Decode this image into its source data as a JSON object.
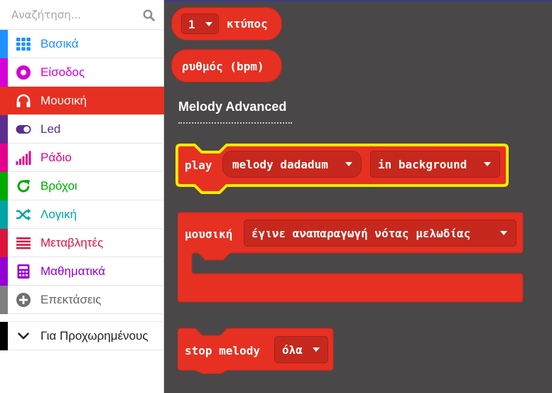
{
  "search": {
    "placeholder": "Αναζήτηση..."
  },
  "categories": [
    {
      "id": "basic",
      "label": "Βασικά",
      "color": "#1e90ff",
      "icon": "grid-icon"
    },
    {
      "id": "input",
      "label": "Είσοδος",
      "color": "#d400d4",
      "icon": "circle-dot-icon"
    },
    {
      "id": "music",
      "label": "Μουσική",
      "color": "#e63022",
      "icon": "headphones-icon",
      "selected": true
    },
    {
      "id": "led",
      "label": "Led",
      "color": "#5c2d91",
      "icon": "toggle-icon"
    },
    {
      "id": "radio",
      "label": "Ράδιο",
      "color": "#e3008c",
      "icon": "signal-bars-icon"
    },
    {
      "id": "loops",
      "label": "Βρόχοι",
      "color": "#00aa00",
      "icon": "refresh-icon"
    },
    {
      "id": "logic",
      "label": "Λογική",
      "color": "#00a4a6",
      "icon": "shuffle-icon"
    },
    {
      "id": "variables",
      "label": "Μεταβλητές",
      "color": "#dc143c",
      "icon": "list-lines-icon"
    },
    {
      "id": "math",
      "label": "Μαθηματικά",
      "color": "#9400d3",
      "icon": "calculator-icon"
    },
    {
      "id": "extensions",
      "label": "Επεκτάσεις",
      "color": "#7f7f7f",
      "icon": "plus-circle-icon"
    }
  ],
  "advanced": {
    "label": "Για Προχωρημένους",
    "icon": "chevron-down-icon",
    "color": "#000000"
  },
  "flyout": {
    "beat_block": {
      "value": "1",
      "label": "κτύπος"
    },
    "tempo_block": {
      "label": "ρυθμός (bpm)"
    },
    "section_label": "Melody Advanced",
    "play_block": {
      "label": "play",
      "melody": "melody dadadum",
      "mode": "in background"
    },
    "music_event_block": {
      "label": "μουσική",
      "event": "έγινε αναπαραγωγή νότας μελωδίας"
    },
    "stop_block": {
      "label": "stop melody",
      "option": "όλα"
    }
  },
  "colors": {
    "workspace": "#4a4748",
    "music": "#e63022",
    "music_dark": "#c6281d",
    "highlight": "#ffea00"
  }
}
